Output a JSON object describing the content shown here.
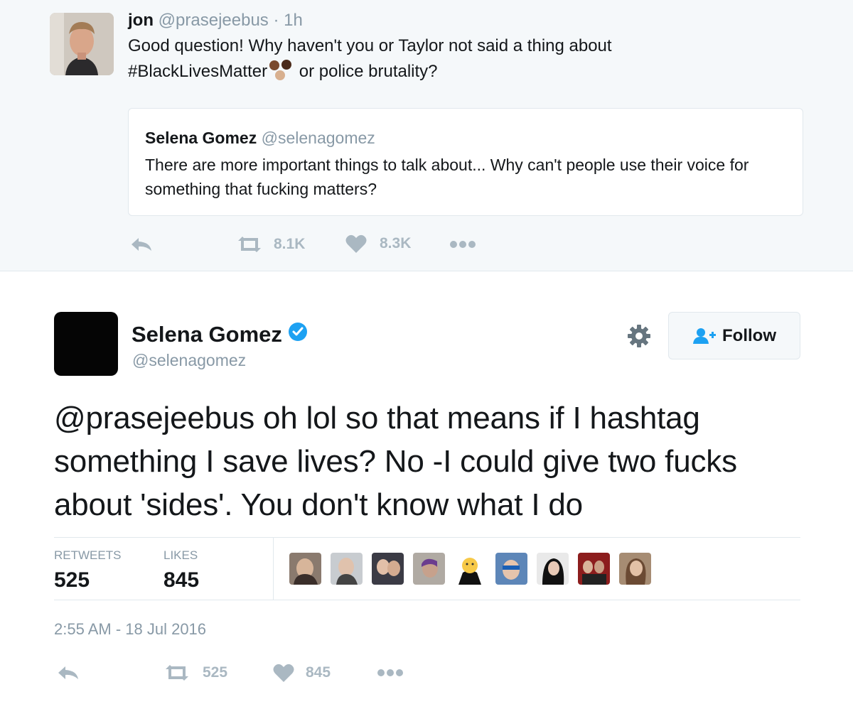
{
  "quoted_reply": {
    "author_name": "jon",
    "author_handle": "@prasejeebus",
    "separator": "·",
    "time": "1h",
    "text_line1": "Good question! Why haven't you or Taylor not said a thing about",
    "hashtag": "#BlackLivesMatter",
    "text_after_hashtag": "or police brutality?",
    "emoji": "raised-fists-emoji",
    "quote": {
      "author_name": "Selena Gomez",
      "author_handle": "@selenagomez",
      "text": "There are more important things to talk about... Why can't people use their voice for something that fucking matters?"
    },
    "actions": {
      "retweets": "8.1K",
      "likes": "8.3K"
    }
  },
  "main_tweet": {
    "author_name": "Selena Gomez",
    "author_handle": "@selenagomez",
    "verified": true,
    "follow_label": "Follow",
    "mention": "@prasejeebus",
    "text": " oh lol so that means if I hashtag something I save lives? No -I could give two fucks about 'sides'. You don't know what I do",
    "stats": {
      "retweets_label": "RETWEETS",
      "retweets_value": "525",
      "likes_label": "LIKES",
      "likes_value": "845"
    },
    "likers_count_shown": 9,
    "timestamp": "2:55 AM - 18 Jul 2016",
    "actions": {
      "retweets": "525",
      "likes": "845"
    }
  },
  "colors": {
    "accent": "#1da1f2",
    "muted": "#8899a6",
    "icon_gray": "#aab8c2",
    "border": "#e1e8ed",
    "background_top": "#f5f8fa"
  }
}
